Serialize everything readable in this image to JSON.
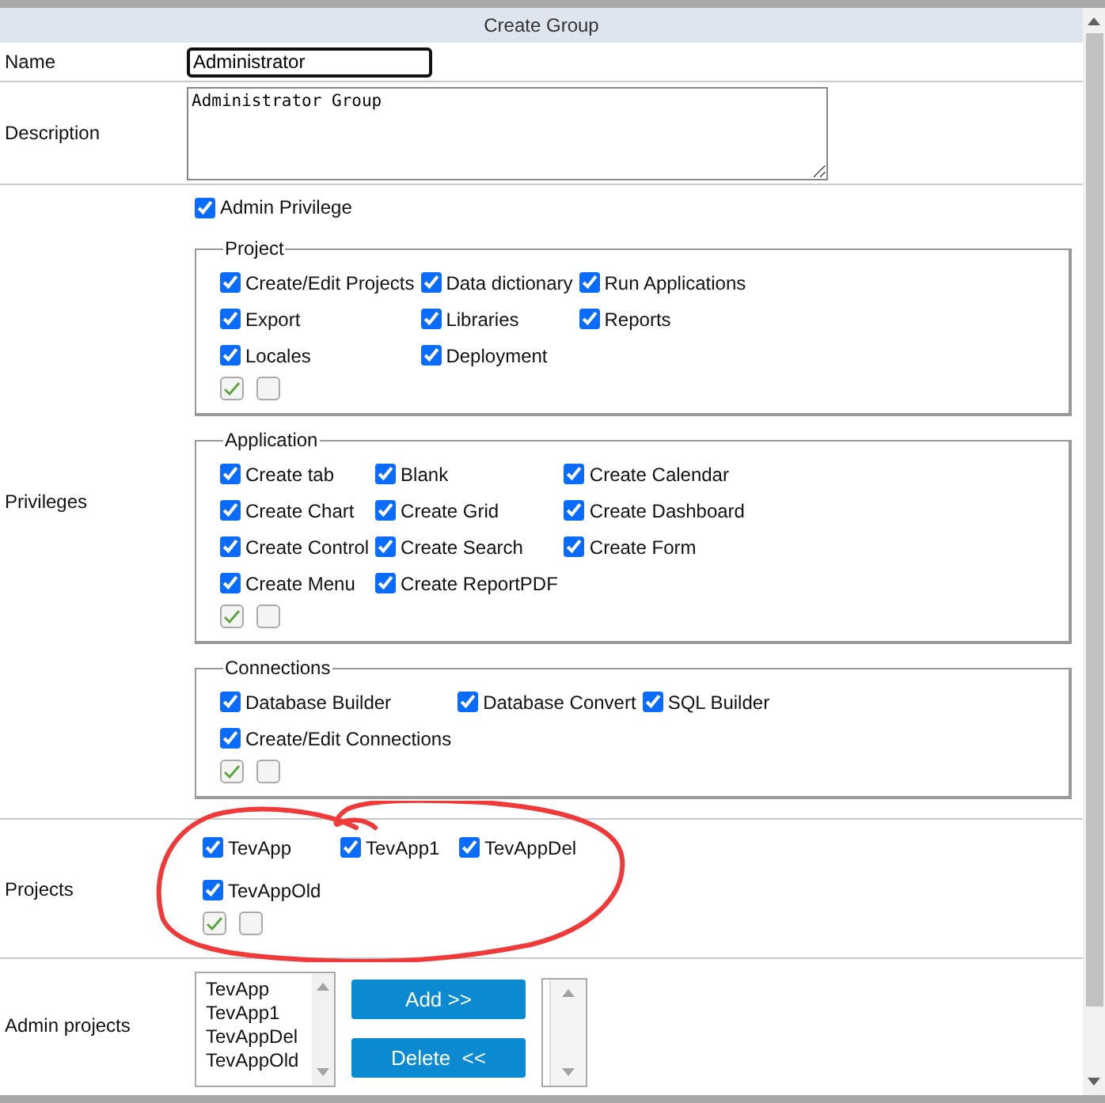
{
  "header": {
    "title": "Create Group"
  },
  "name": {
    "label": "Name",
    "value": "Administrator"
  },
  "description": {
    "label": "Description",
    "value": "Administrator Group"
  },
  "privileges": {
    "label": "Privileges",
    "admin": {
      "label": "Admin Privilege",
      "checked": true
    },
    "groups": [
      {
        "title": "Project",
        "items": [
          {
            "label": "Create/Edit Projects",
            "checked": true
          },
          {
            "label": "Data dictionary",
            "checked": true
          },
          {
            "label": "Run Applications",
            "checked": true
          },
          {
            "label": "Export",
            "checked": true
          },
          {
            "label": "Libraries",
            "checked": true
          },
          {
            "label": "Reports",
            "checked": true
          },
          {
            "label": "Locales",
            "checked": true
          },
          {
            "label": "Deployment",
            "checked": true
          }
        ]
      },
      {
        "title": "Application",
        "items": [
          {
            "label": "Create tab",
            "checked": true
          },
          {
            "label": "Blank",
            "checked": true
          },
          {
            "label": "Create Calendar",
            "checked": true
          },
          {
            "label": "Create Chart",
            "checked": true
          },
          {
            "label": "Create Grid",
            "checked": true
          },
          {
            "label": "Create Dashboard",
            "checked": true
          },
          {
            "label": "Create Control",
            "checked": true
          },
          {
            "label": "Create Search",
            "checked": true
          },
          {
            "label": "Create Form",
            "checked": true
          },
          {
            "label": "Create Menu",
            "checked": true
          },
          {
            "label": "Create ReportPDF",
            "checked": true
          }
        ]
      },
      {
        "title": "Connections",
        "items": [
          {
            "label": "Database Builder",
            "checked": true
          },
          {
            "label": "Database Convert",
            "checked": true
          },
          {
            "label": "SQL Builder",
            "checked": true
          },
          {
            "label": "Create/Edit Connections",
            "checked": true
          }
        ]
      }
    ]
  },
  "projects": {
    "label": "Projects",
    "items": [
      {
        "label": "TevApp",
        "checked": true
      },
      {
        "label": "TevApp1",
        "checked": true
      },
      {
        "label": "TevAppDel",
        "checked": true
      },
      {
        "label": "TevAppOld",
        "checked": true
      }
    ]
  },
  "admin_projects": {
    "label": "Admin projects",
    "available": [
      "TevApp",
      "TevApp1",
      "TevAppDel",
      "TevAppOld"
    ],
    "add_button": "Add >>",
    "delete_button": "Delete  <<"
  }
}
